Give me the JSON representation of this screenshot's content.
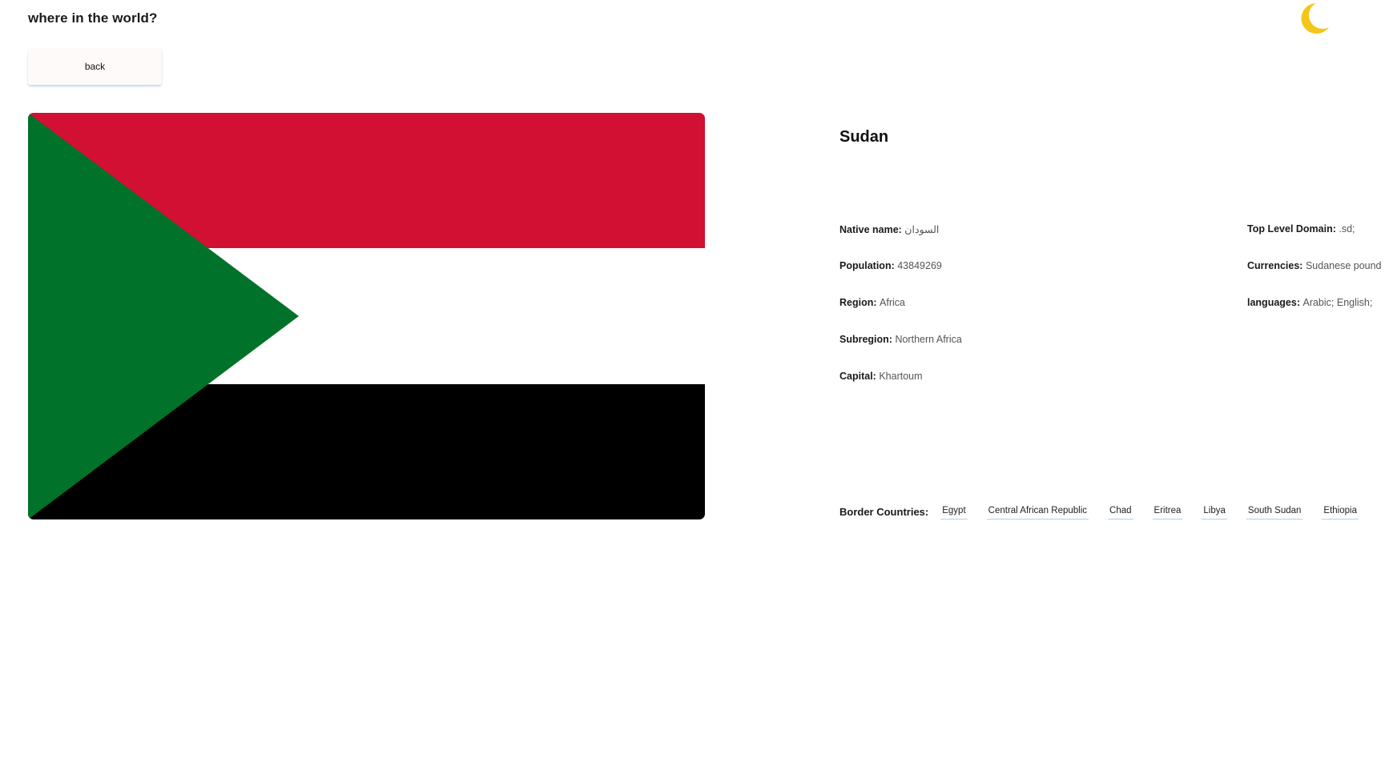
{
  "header": {
    "app_title": "where in the world?",
    "theme_toggle_icon": "moon-icon",
    "moon_color": "#f5c518"
  },
  "navigation": {
    "back_label": "back"
  },
  "country": {
    "name": "Sudan",
    "flag_colors": {
      "red": "#d21034",
      "white": "#ffffff",
      "black": "#000000",
      "green": "#007229"
    },
    "details_left": [
      {
        "label": "Native name:",
        "value": "السودان"
      },
      {
        "label": "Population:",
        "value": "43849269"
      },
      {
        "label": "Region:",
        "value": "Africa"
      },
      {
        "label": "Subregion:",
        "value": "Northern Africa"
      },
      {
        "label": "Capital:",
        "value": "Khartoum"
      }
    ],
    "details_right": [
      {
        "label": "Top Level Domain:",
        "value": ".sd;"
      },
      {
        "label": "Currencies:",
        "value": "Sudanese pound"
      },
      {
        "label": "languages:",
        "value": "Arabic; English;"
      }
    ],
    "border_countries_label": "Border Countries:",
    "border_countries": [
      "Egypt",
      "Central African Republic",
      "Chad",
      "Eritrea",
      "Libya",
      "South Sudan",
      "Ethiopia"
    ]
  }
}
